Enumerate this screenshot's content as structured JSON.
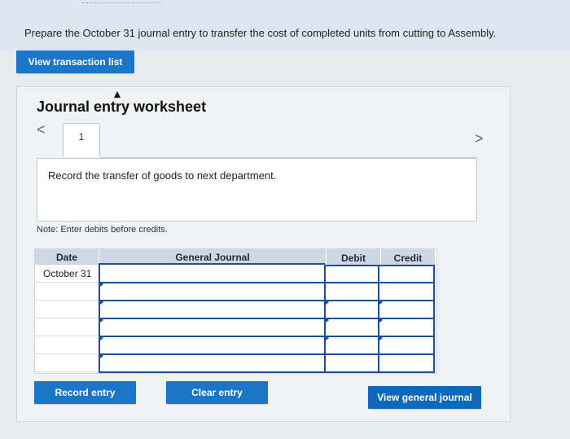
{
  "prompt": "Prepare the October 31 journal entry to transfer the cost of  completed units from cutting to Assembly.",
  "buttons": {
    "view_transaction_list": "View transaction list",
    "record_entry": "Record entry",
    "clear_entry": "Clear entry",
    "view_general_journal": "View general journal"
  },
  "worksheet": {
    "title": "Journal entry worksheet",
    "nav_prev": "<",
    "nav_next": ">",
    "tab_number": "1",
    "description": "Record the transfer of goods to next department.",
    "note": "Note: Enter debits before credits."
  },
  "table": {
    "headers": {
      "date": "Date",
      "general_journal": "General Journal",
      "debit": "Debit",
      "credit": "Credit"
    },
    "rows": [
      {
        "date": "October 31",
        "account": "",
        "debit": "",
        "credit": ""
      },
      {
        "date": "",
        "account": "",
        "debit": "",
        "credit": ""
      },
      {
        "date": "",
        "account": "",
        "debit": "",
        "credit": ""
      },
      {
        "date": "",
        "account": "",
        "debit": "",
        "credit": ""
      },
      {
        "date": "",
        "account": "",
        "debit": "",
        "credit": ""
      },
      {
        "date": "",
        "account": "",
        "debit": "",
        "credit": ""
      }
    ]
  },
  "colors": {
    "button": "#1c76c7",
    "header": "#cdd7e4",
    "input_border": "#1b4f9a"
  }
}
